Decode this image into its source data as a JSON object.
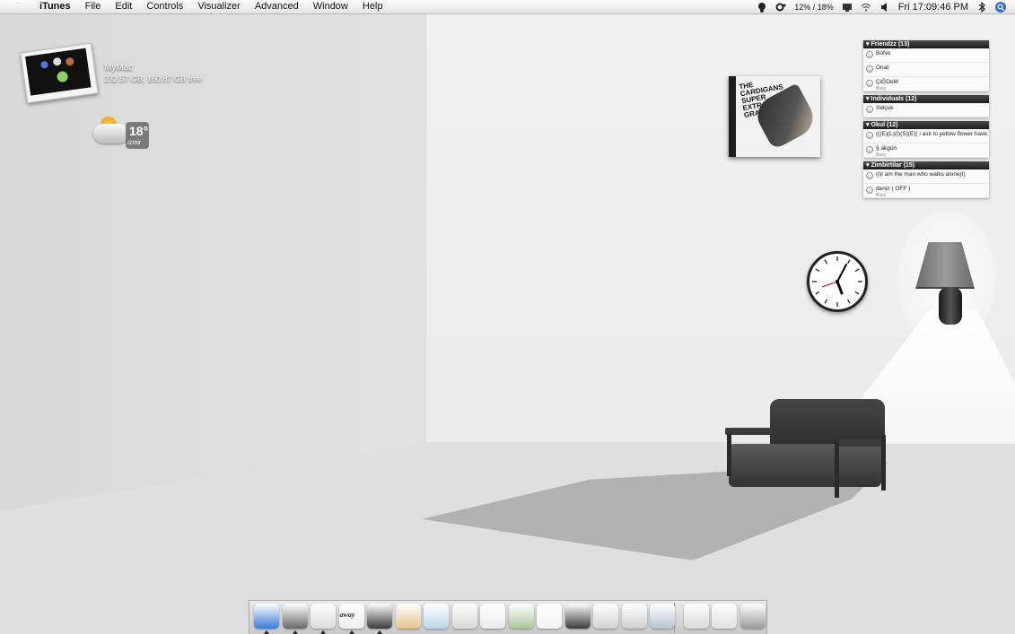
{
  "menubar": {
    "apple_icon": "apple-icon",
    "app_name": "iTunes",
    "items": [
      "File",
      "Edit",
      "Controls",
      "Visualizer",
      "Advanced",
      "Window",
      "Help"
    ],
    "cpu_label": "12% / 18%",
    "clock": "Fri 17:09:46 PM"
  },
  "desktop": {
    "disk": {
      "name": "MyMac",
      "info": "232.57 GB, 160.87 GB free"
    },
    "weather": {
      "temperature": "18°",
      "city": "Izmir"
    },
    "album": {
      "title_text": "The Cardigans Super Extra Gravity"
    }
  },
  "buddy_list": {
    "groups": [
      {
        "name": "Friendzz (13)",
        "buddies": [
          {
            "name": "BoNo",
            "status": ""
          },
          {
            "name": "Onat",
            "status": ""
          },
          {
            "name": "ÇiĞDeM",
            "status": "Busy"
          }
        ]
      },
      {
        "name": "Individuals (12)",
        "buddies": [
          {
            "name": "Selçuk",
            "status": ""
          }
        ]
      },
      {
        "name": "Okul (12)",
        "buddies": [
          {
            "name": "(((E)(L)(İ)(S)(E)( i ask to yellow flower have...",
            "status": ""
          },
          {
            "name": "§ akgün",
            "status": "Busy"
          }
        ]
      },
      {
        "name": "Zimbirtilar (15)",
        "buddies": [
          {
            "name": "(I)I am the man who walks alone(I)",
            "status": ""
          },
          {
            "name": "deniz ( OFF )",
            "status": "Busy"
          }
        ]
      }
    ]
  },
  "dock": {
    "icons": [
      {
        "name": "finder-icon",
        "color": "#3b7bd8",
        "running": true
      },
      {
        "name": "safari-icon",
        "color": "#6a6a6a",
        "running": true
      },
      {
        "name": "mail-icon",
        "color": "#dcdcdc",
        "running": true
      },
      {
        "name": "adium-away-icon",
        "color": "#efefef",
        "running": true,
        "label": "away"
      },
      {
        "name": "itunes-icon",
        "color": "#3a3a3a",
        "running": true
      },
      {
        "name": "ichat-icon",
        "color": "#e6c38d",
        "running": false
      },
      {
        "name": "preview-icon",
        "color": "#bcd6ea",
        "running": false
      },
      {
        "name": "imovie-icon",
        "color": "#d8d8d8",
        "running": false
      },
      {
        "name": "final-cut-icon",
        "color": "#ececec",
        "running": false
      },
      {
        "name": "iphoto-icon",
        "color": "#a9c79a",
        "running": false
      },
      {
        "name": "address-book-icon",
        "color": "#f2f2f2",
        "running": false
      },
      {
        "name": "garageband-icon",
        "color": "#3a3a3a",
        "running": false
      },
      {
        "name": "hairdryer-icon",
        "color": "#d2d2d2",
        "running": false
      },
      {
        "name": "apple-dock-icon",
        "color": "#cfcfcf",
        "running": false
      },
      {
        "name": "dashboard-icon",
        "color": "#b5c4d0",
        "running": false
      },
      {
        "name": "desktop-folder-icon",
        "color": "#d9d9d9",
        "running": false
      },
      {
        "name": "downloads-stack-icon",
        "color": "#e1e1e1",
        "running": false
      },
      {
        "name": "trash-icon",
        "color": "#9a9a9a",
        "running": false
      }
    ]
  },
  "colors": {
    "menubar_bg": "#ececec",
    "buddy_header": "#2a2a2a",
    "accent_blue": "#3b7bd8"
  }
}
